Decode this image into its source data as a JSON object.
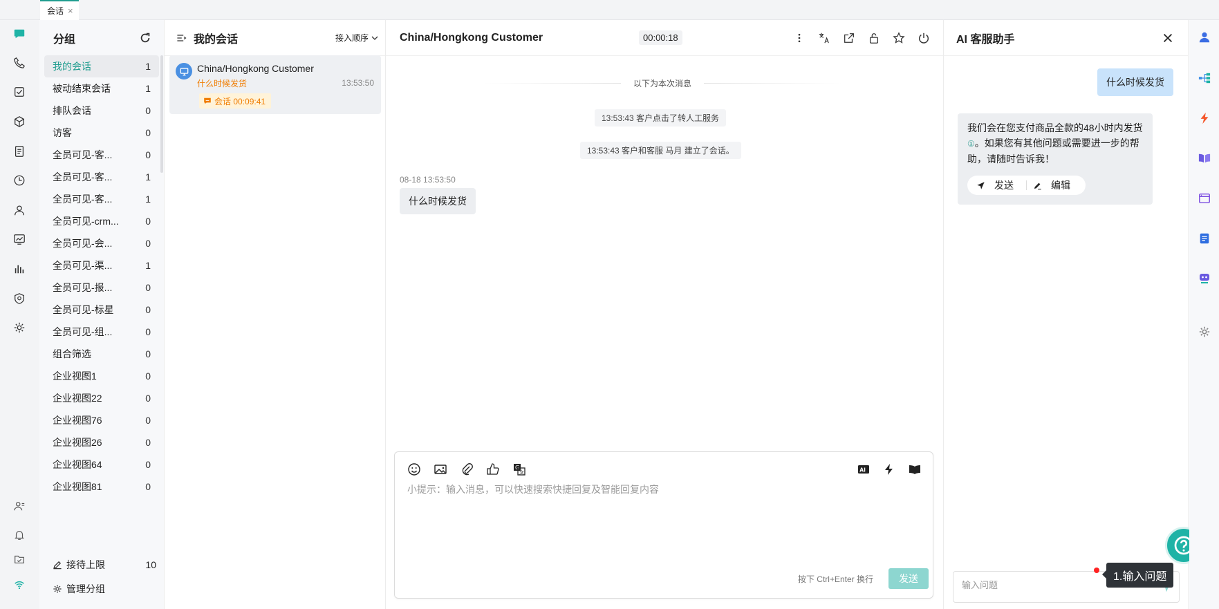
{
  "tabbar": {
    "tab_label": "会话",
    "tab_close": "×"
  },
  "groups": {
    "title": "分组",
    "items": [
      {
        "label": "我的会话",
        "count": "1"
      },
      {
        "label": "被动结束会话",
        "count": "1"
      },
      {
        "label": "排队会话",
        "count": "0"
      },
      {
        "label": "访客",
        "count": "0"
      },
      {
        "label": "全员可见-客...",
        "count": "0"
      },
      {
        "label": "全员可见-客...",
        "count": "1"
      },
      {
        "label": "全员可见-客...",
        "count": "1"
      },
      {
        "label": "全员可见-crm...",
        "count": "0"
      },
      {
        "label": "全员可见-会...",
        "count": "0"
      },
      {
        "label": "全员可见-渠...",
        "count": "1"
      },
      {
        "label": "全员可见-报...",
        "count": "0"
      },
      {
        "label": "全员可见-标星",
        "count": "0"
      },
      {
        "label": "全员可见-组...",
        "count": "0"
      },
      {
        "label": "组合筛选",
        "count": "0"
      },
      {
        "label": "企业视图1",
        "count": "0"
      },
      {
        "label": "企业视图22",
        "count": "0"
      },
      {
        "label": "企业视图76",
        "count": "0"
      },
      {
        "label": "企业视图26",
        "count": "0"
      },
      {
        "label": "企业视图64",
        "count": "0"
      },
      {
        "label": "企业视图81",
        "count": "0"
      }
    ],
    "reception_limit_label": "接待上限",
    "reception_limit_value": "10",
    "manage_label": "管理分组"
  },
  "convs": {
    "title": "我的会话",
    "sort_label": "接入顺序",
    "items": [
      {
        "name": "China/Hongkong Customer",
        "last_message": "什么时候发货",
        "time": "13:53:50",
        "badge": "会话 00:09:41"
      }
    ]
  },
  "chat": {
    "title": "China/Hongkong Customer",
    "timer": "00:00:18",
    "divider": "以下为本次消息",
    "system_messages": [
      "13:53:43 客户点击了转人工服务",
      "13:53:43 客户和客服 马月 建立了会话。"
    ],
    "message_meta": "08-18 13:53:50",
    "message_text": "什么时候发货",
    "composer_placeholder": "小提示：输入消息，可以快速搜索快捷回复及智能回复内容",
    "hint": "按下 Ctrl+Enter 换行",
    "send_label": "发送",
    "ai_tool_label": "AI"
  },
  "ai": {
    "title": "AI 客服助手",
    "question": "什么时候发货",
    "answer_part1": "我们会在您支付商品全款的48小时内发货",
    "answer_ref": "①",
    "answer_part2": "。如果您有其他问题或需要进一步的帮助，请随时告诉我！",
    "send_label": "发送",
    "edit_label": "编辑",
    "input_placeholder": "输入问题",
    "tooltip": "1.输入问题"
  },
  "colors": {
    "accent": "#1f9d8f",
    "orange": "#f07c00",
    "question_bubble": "#c9e3fb",
    "send_disabled": "#8dd6d0"
  }
}
